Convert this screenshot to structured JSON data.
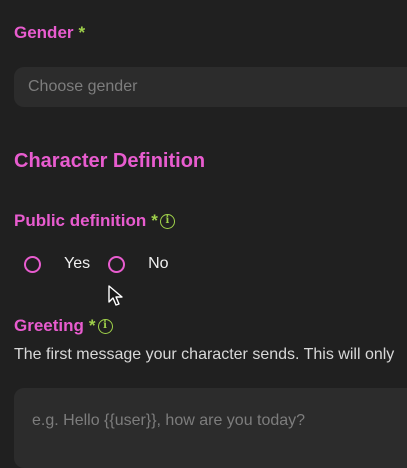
{
  "gender": {
    "label": "Gender",
    "required_mark": "*",
    "placeholder": "Choose gender"
  },
  "character_definition": {
    "title": "Character Definition"
  },
  "public_definition": {
    "label": "Public definition",
    "required_mark": "*",
    "info_icon": "info-icon",
    "options": [
      {
        "label": "Yes",
        "selected": false
      },
      {
        "label": "No",
        "selected": false
      }
    ]
  },
  "greeting": {
    "label": "Greeting",
    "required_mark": "*",
    "info_icon": "info-icon",
    "helper": "The first message your character sends. This will only",
    "placeholder": "e.g. Hello {{user}}, how are you today?"
  },
  "colors": {
    "background": "#202020",
    "accent": "#e85ccf",
    "required": "#9fd14a",
    "field": "#2c2c2c"
  }
}
